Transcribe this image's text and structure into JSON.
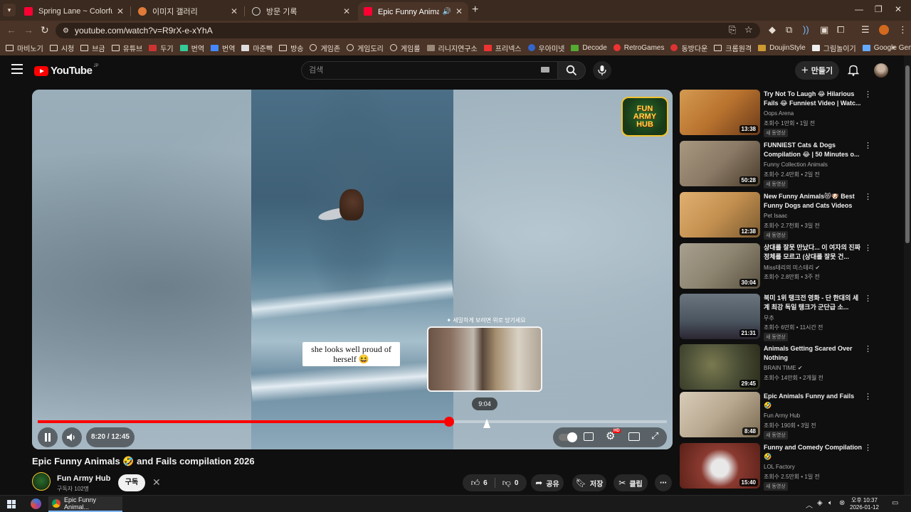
{
  "browser": {
    "tabs": [
      {
        "title": "Spring Lane ~ Colorful Path -",
        "favicon_color": "#ff0033",
        "active": false
      },
      {
        "title": "이미지 갤러리",
        "favicon_color": "#e07b39",
        "active": false
      },
      {
        "title": "방문 기록",
        "favicon_color": "#cccccc",
        "active": false
      },
      {
        "title": "Epic Funny Animals 🤣 an",
        "favicon_color": "#ff0033",
        "active": true
      }
    ],
    "url": "youtube.com/watch?v=R9rX-e-xYhA",
    "bookmarks": [
      "마비노기",
      "시청",
      "브금",
      "유튜브",
      "두기",
      "번역",
      "번역",
      "마준빡",
      "방송",
      "게임존",
      "게임도리",
      "게임룰",
      "리니지연구소",
      "프리넥스",
      "우아미넷",
      "Decode",
      "RetroGames",
      "동방다운",
      "크롬원격",
      "DoujinStyle",
      "그림놀이기",
      "Google Gemini"
    ]
  },
  "header": {
    "logo_text": "YouTube",
    "logo_region": "JP",
    "search_placeholder": "검색",
    "create_label": "만들기"
  },
  "player": {
    "caption": "she looks well proud of herself 😆",
    "preview_hint": "✦ 세밀하게 보려면 위로 당기세요",
    "preview_time": "9:04",
    "time_display": "8:20 / 12:45",
    "progress": 0.6536,
    "badge_line1": "FUN",
    "badge_line2": "ARMY",
    "badge_line3": "HUB"
  },
  "video": {
    "title": "Epic Funny Animals 🤣 and Fails compilation 2026",
    "channel": "Fun Army Hub",
    "subscribers": "구독자 102명",
    "subscribe_label": "구독",
    "likes": "6",
    "dislikes": "0",
    "share_label": "공유",
    "save_label": "저장",
    "clip_label": "클립"
  },
  "recommendations": [
    {
      "title": "Try Not To Laugh 😂 Hilarious Fails 😂 Funniest Video | Watc...",
      "channel": "Oops Arena",
      "meta": "조회수 1만회 • 1일 전",
      "badge": "새 동영상",
      "duration": "13:38",
      "thumb": "#b8722e"
    },
    {
      "title": "FUNNIEST Cats & Dogs Compilation 😂 | 50 Minutes o...",
      "channel": "Funny Collection Animals",
      "meta": "조회수 2.4만회 • 2일 전",
      "badge": "새 동영상",
      "duration": "50:28",
      "thumb": "#8a7a66"
    },
    {
      "title": "New Funny Animals😻🐶 Best Funny Dogs and Cats Videos O...",
      "channel": "Pet Isaac",
      "meta": "조회수 2.7천회 • 3일 전",
      "badge": "새 동영상",
      "duration": "12:38",
      "thumb": "#c49050"
    },
    {
      "title": "상대를 잘못 만났다... 이 여자의 진짜 정체를 모르고 (상대를 잘못 건...",
      "channel": "Miss테리의 미스테리 ✔",
      "meta": "조회수 2.8만회 • 3주 전",
      "badge": "",
      "duration": "30:04",
      "thumb": "#8d8470"
    },
    {
      "title": "북미 1위 탱크전 영화 - 단 한대의 세계 최강 독일 탱크가 군단급 소...",
      "channel": "무추",
      "meta": "조회수 6만회 • 11시간 전",
      "badge": "새 동영상",
      "duration": "21:31",
      "thumb": "#4a5560"
    },
    {
      "title": "Animals Getting Scared Over Nothing",
      "channel": "BRAIN TIME ✔",
      "meta": "조회수 14만회 • 2개월 전",
      "badge": "",
      "duration": "29:45",
      "thumb": "#4b4f36"
    },
    {
      "title": "Epic Animals Funny and Fails 🤣",
      "channel": "Fun Army Hub",
      "meta": "조회수 190회 • 3일 전",
      "badge": "새 동영상",
      "duration": "8:48",
      "thumb": "#b8a890"
    },
    {
      "title": "Funny and Comedy Compilation 🤣",
      "channel": "LOL Factory",
      "meta": "조회수 2.5만회 • 1일 전",
      "badge": "새 동영상",
      "duration": "15:40",
      "thumb": "#8a3a30"
    }
  ],
  "taskbar": {
    "app_label": "Epic Funny Animal...",
    "clock_time": "오후 10:37",
    "clock_date": "2026-01-12"
  }
}
